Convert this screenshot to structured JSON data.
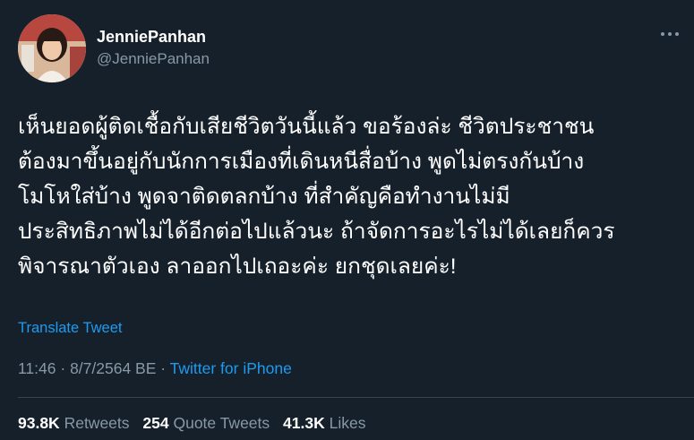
{
  "author": {
    "display_name": "JenniePanhan",
    "handle": "@JenniePanhan",
    "avatar_icon": "profile-photo"
  },
  "more_icon": "ellipsis-icon",
  "tweet": {
    "text": "เห็นยอดผู้ติดเชื้อกับเสียชีวิตวันนี้แล้ว ขอร้องล่ะ ชีวิตประชาชน\nต้องมาขึ้นอยู่กับนักการเมืองที่เดินหนีสื่อบ้าง พูดไม่ตรงกันบ้าง\nโมโหใส่บ้าง พูดจาติดตลกบ้าง ที่สำคัญคือทำงานไม่มี\nประสิทธิภาพไม่ได้อีกต่อไปแล้วนะ ถ้าจัดการอะไรไม่ได้เลยก็ควร\nพิจารณาตัวเอง ลาออกไปเถอะค่ะ ยกชุดเลยค่ะ!",
    "translate_label": "Translate Tweet",
    "time": "11:46",
    "separator": "·",
    "date": "8/7/2564 BE",
    "source": "Twitter for iPhone"
  },
  "stats": {
    "retweets": {
      "count": "93.8K",
      "label": "Retweets"
    },
    "quote_tweets": {
      "count": "254",
      "label": "Quote Tweets"
    },
    "likes": {
      "count": "41.3K",
      "label": "Likes"
    }
  },
  "colors": {
    "background": "#15202b",
    "text": "#ffffff",
    "secondary": "#8899a6",
    "link": "#1d9bf0",
    "divider": "#38444d"
  }
}
